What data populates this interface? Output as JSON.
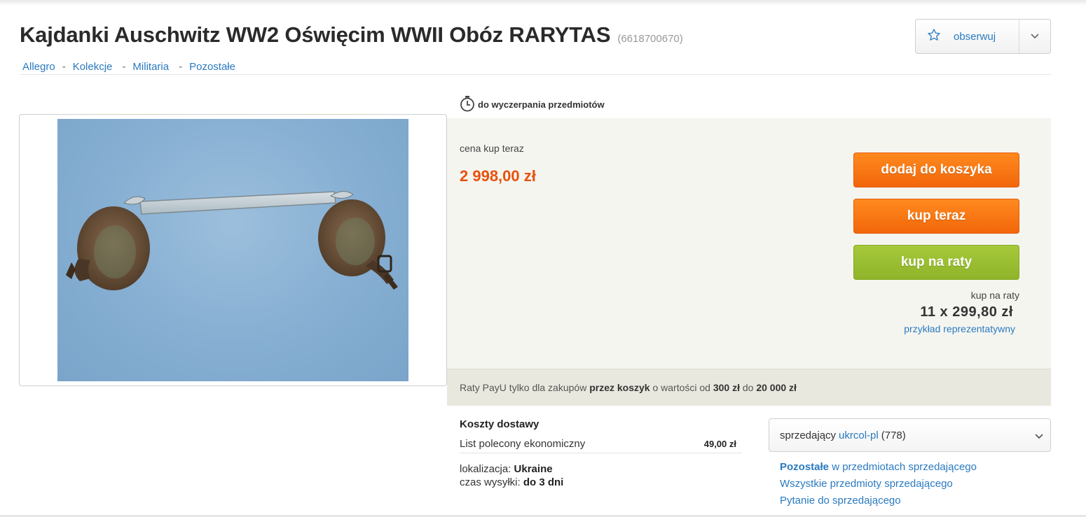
{
  "listing": {
    "title": "Kajdanki Auschwitz WW2 Oświęcim WWII Obóz RARYTAS",
    "id": "(6618700670)"
  },
  "breadcrumb": [
    "Allegro",
    "Kolekcje",
    "Militaria",
    "Pozostałe"
  ],
  "breadcrumb_separator": "-",
  "watch": {
    "label": "obserwuj",
    "icon": "star-icon",
    "dropdown_icon": "chevron-down-icon"
  },
  "timer": {
    "icon": "stopwatch-icon",
    "text": "do wyczerpania przedmiotów"
  },
  "purchase": {
    "price_label": "cena kup teraz",
    "price": "2 998,00 zł",
    "add_to_cart": "dodaj do koszyka",
    "buy_now": "kup teraz",
    "buy_installments": "kup na raty",
    "installments_label": "kup na raty",
    "installments_amount": "11 x 299,80 zł",
    "installments_example": "przykład reprezentatywny"
  },
  "payu": {
    "t1": "Raty PayU tylko dla zakupów ",
    "b1": "przez koszyk",
    "t2": " o wartości od ",
    "b2": "300 zł",
    "t3": " do ",
    "b3": "20 000 zł"
  },
  "shipping": {
    "title": "Koszty dostawy",
    "method": "List polecony ekonomiczny",
    "price": "49,00 zł",
    "location_label": "lokalizacja: ",
    "location_value": "Ukraine",
    "dispatch_label": "czas wysyłki: ",
    "dispatch_value": "do 3 dni"
  },
  "seller": {
    "prefix": "sprzedający",
    "name": "ukrcol-pl",
    "rating": "(778)",
    "other_bold": "Pozostałe",
    "other_rest": " w przedmiotach sprzedającego",
    "all_items": "Wszystkie przedmioty sprzedającego",
    "ask": "Pytanie do sprzedającego"
  },
  "colors": {
    "accent_orange": "#f2660a",
    "price_red": "#e8520c",
    "green": "#8fb42a",
    "link_blue": "#2a7ac0"
  }
}
